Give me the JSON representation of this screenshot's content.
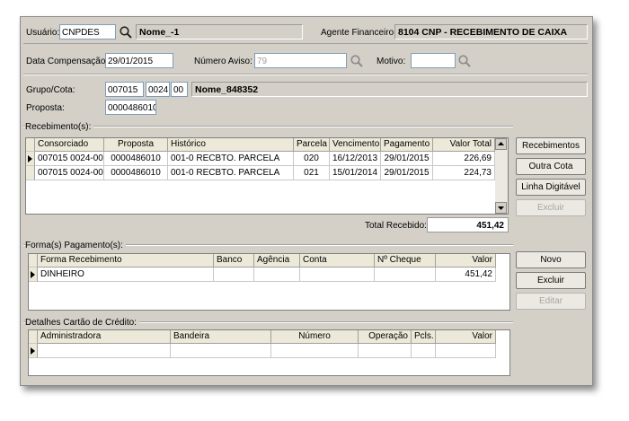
{
  "header": {
    "usuario_label": "Usuário:",
    "usuario_value": "CNPDES",
    "nome_value": "Nome_-1",
    "agente_label": "Agente Financeiro:",
    "agente_value": "8104  CNP - RECEBIMENTO DE CAIXA"
  },
  "filters": {
    "data_comp_label": "Data Compensação:",
    "data_comp_value": "29/01/2015",
    "numero_aviso_label": "Número Aviso:",
    "numero_aviso_value": "79",
    "motivo_label": "Motivo:",
    "motivo_value": ""
  },
  "grupo": {
    "label": "Grupo/Cota:",
    "grupo_value": "007015",
    "cota_value": "0024",
    "digit_value": "00",
    "nome_value": "Nome_848352",
    "proposta_label": "Proposta:",
    "proposta_value": "0000486010"
  },
  "recebimentos": {
    "section_label": "Recebimento(s):",
    "columns": [
      "Consorciado",
      "Proposta",
      "Histórico",
      "Parcela",
      "Vencimento",
      "Pagamento",
      "Valor Total"
    ],
    "rows": [
      [
        "007015 0024-00",
        "0000486010",
        "001-0 RECBTO. PARCELA",
        "020",
        "16/12/2013",
        "29/01/2015",
        "226,69"
      ],
      [
        "007015 0024-00",
        "0000486010",
        "001-0 RECBTO. PARCELA",
        "021",
        "15/01/2014",
        "29/01/2015",
        "224,73"
      ]
    ],
    "total_label": "Total Recebido:",
    "total_value": "451,42",
    "buttons": {
      "recebimentos": "Recebimentos",
      "outra_cota": "Outra Cota",
      "linha_digitavel": "Linha Digitável",
      "excluir": "Excluir"
    }
  },
  "pagamentos": {
    "section_label": "Forma(s) Pagamento(s):",
    "columns": [
      "Forma Recebimento",
      "Banco",
      "Agência",
      "Conta",
      "Nº Cheque",
      "Valor"
    ],
    "rows": [
      [
        "DINHEIRO",
        "",
        "",
        "",
        "",
        "451,42"
      ]
    ],
    "buttons": {
      "novo": "Novo",
      "excluir": "Excluir",
      "editar": "Editar"
    }
  },
  "cartao": {
    "section_label": "Detalhes Cartão de Crédito:",
    "columns": [
      "Administradora",
      "Bandeira",
      "Número",
      "Operação",
      "Pcls.",
      "Valor"
    ]
  },
  "icons": {
    "search": "magnifier-icon",
    "row_pointer": "row-pointer-icon",
    "scroll_up": "scroll-up-arrow-icon",
    "scroll_down": "scroll-down-arrow-icon"
  }
}
